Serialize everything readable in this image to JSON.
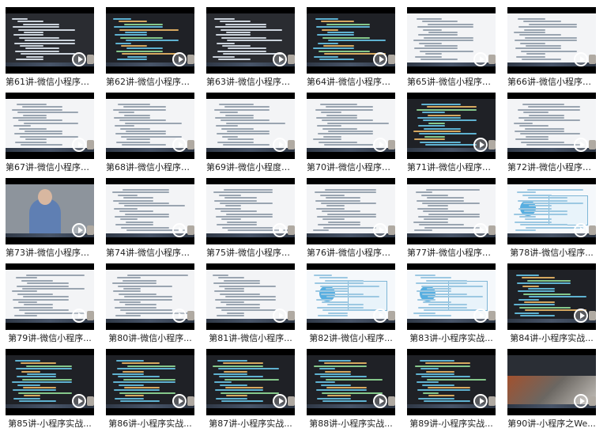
{
  "videos": [
    {
      "title": "第61讲-微信小程序A...",
      "kind": "mixed"
    },
    {
      "title": "第62讲-微信小程序A...",
      "kind": "dark"
    },
    {
      "title": "第63讲-微信小程序A...",
      "kind": "mixed"
    },
    {
      "title": "第64讲-微信小程序A...",
      "kind": "dark"
    },
    {
      "title": "第65讲-微信小程序A...",
      "kind": "light"
    },
    {
      "title": "第66讲-微信小程序A...",
      "kind": "light"
    },
    {
      "title": "第67讲-微信小程序A...",
      "kind": "light"
    },
    {
      "title": "第68讲-微信小程序A...",
      "kind": "light"
    },
    {
      "title": "第69讲-微信小程度A...",
      "kind": "light"
    },
    {
      "title": "第70讲-微信小程序A...",
      "kind": "light"
    },
    {
      "title": "第71讲-微信小程序A...",
      "kind": "dark"
    },
    {
      "title": "第72讲-微信小程序A...",
      "kind": "light"
    },
    {
      "title": "第73讲-微信小程序A...",
      "kind": "person"
    },
    {
      "title": "第74讲-微信小程序A...",
      "kind": "light"
    },
    {
      "title": "第75讲-微信小程序A...",
      "kind": "light"
    },
    {
      "title": "第76讲-微信小程序A...",
      "kind": "light"
    },
    {
      "title": "第77讲-微信小程序A...",
      "kind": "light"
    },
    {
      "title": "第78讲-微信小程序...",
      "kind": "slide"
    },
    {
      "title": "第79讲-微信小程序...",
      "kind": "light"
    },
    {
      "title": "第80讲-微信小程序...",
      "kind": "light"
    },
    {
      "title": "第81讲-微信小程序...",
      "kind": "light"
    },
    {
      "title": "第82讲-微信小程序...",
      "kind": "slide"
    },
    {
      "title": "第83讲-小程序实战...",
      "kind": "slide"
    },
    {
      "title": "第84讲-小程序实战...",
      "kind": "dark"
    },
    {
      "title": "第85讲-小程序实战...",
      "kind": "dark"
    },
    {
      "title": "第86讲-小程序实战...",
      "kind": "dark"
    },
    {
      "title": "第87讲-小程序实战...",
      "kind": "dark"
    },
    {
      "title": "第88讲-小程序实战...",
      "kind": "dark"
    },
    {
      "title": "第89讲-小程序实战...",
      "kind": "dark"
    },
    {
      "title": "第90讲-小程序之We...",
      "kind": "photo"
    }
  ]
}
